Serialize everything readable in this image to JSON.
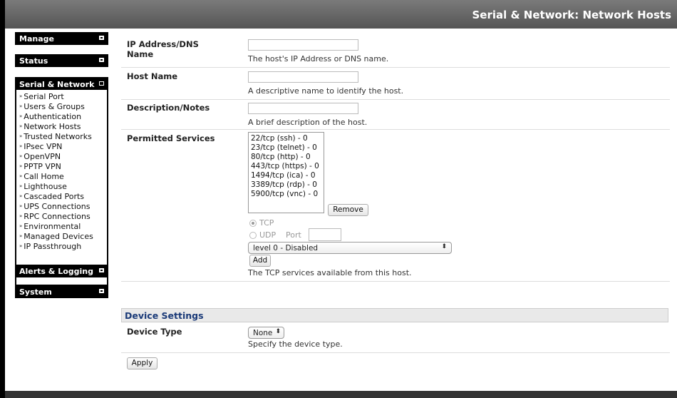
{
  "header": {
    "title": "Serial & Network: Network Hosts"
  },
  "sidebar": {
    "manage": "Manage",
    "status": "Status",
    "serial_network": "Serial & Network",
    "items": [
      "Serial Port",
      "Users & Groups",
      "Authentication",
      "Network Hosts",
      "Trusted Networks",
      "IPsec VPN",
      "OpenVPN",
      "PPTP VPN",
      "Call Home",
      "Lighthouse",
      "Cascaded Ports",
      "UPS Connections",
      "RPC Connections",
      "Environmental",
      "Managed Devices",
      "IP Passthrough"
    ],
    "alerts": "Alerts & Logging",
    "system": "System"
  },
  "form": {
    "ip_label_1": "IP Address/DNS",
    "ip_label_2": "Name",
    "ip_value": "",
    "ip_hint": "The host's IP Address or DNS name.",
    "host_label": "Host Name",
    "host_value": "",
    "host_hint": "A descriptive name to identify the host.",
    "desc_label": "Description/Notes",
    "desc_value": "",
    "desc_hint": "A brief description of the host.",
    "services_label": "Permitted Services",
    "services": [
      "22/tcp (ssh) - 0",
      "23/tcp (telnet) - 0",
      "80/tcp (http) - 0",
      "443/tcp (https) - 0",
      "1494/tcp (ica) - 0",
      "3389/tcp (rdp) - 0",
      "5900/tcp (vnc) - 0"
    ],
    "remove_label": "Remove",
    "tcp_label": "TCP",
    "udp_label": "UDP",
    "port_label": "Port",
    "port_value": "",
    "level_selected": "level 0 - Disabled",
    "add_label": "Add",
    "services_hint": "The TCP services available from this host."
  },
  "device": {
    "section_title": "Device Settings",
    "type_label": "Device Type",
    "type_selected": "None",
    "type_hint": "Specify the device type."
  },
  "apply_label": "Apply"
}
